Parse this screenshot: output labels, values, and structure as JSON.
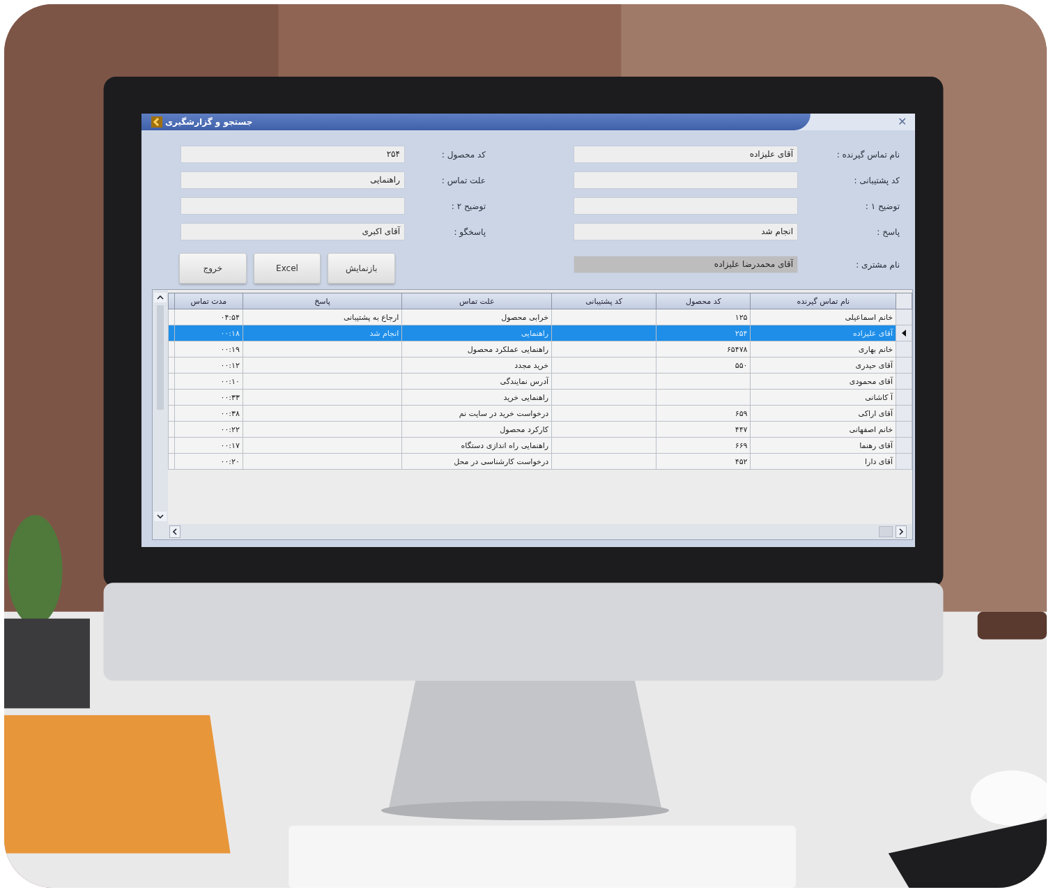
{
  "window": {
    "title": "جستجو و گزارشگیری",
    "close": "✕"
  },
  "form": {
    "right": [
      {
        "label": "نام تماس گیرنده :",
        "value": "آقای علیزاده",
        "disabled": false
      },
      {
        "label": "کد پشتیبانی :",
        "disabled": false
      },
      {
        "label": "توضیح ۱ :",
        "disabled": false
      },
      {
        "label": "پاسخ :",
        "value": "انجام شد",
        "disabled": false
      },
      {
        "label": "نام مشتری :",
        "value": "آقای محمدرضا علیزاده",
        "disabled": true
      }
    ],
    "left": [
      {
        "label": "کد محصول :",
        "value": "۲۵۴",
        "disabled": false
      },
      {
        "label": "علت تماس :",
        "value": "راهنمایی",
        "disabled": false
      },
      {
        "label": "توضیح ۲ :",
        "disabled": false
      },
      {
        "label": "پاسخگو :",
        "value": "آقای اکبری",
        "disabled": false
      }
    ]
  },
  "buttons": [
    "بازنمایش",
    "Excel",
    "خروج"
  ],
  "table": {
    "columns": [
      "نام تماس گیرنده",
      "کد محصول",
      "کد پشتیبانی",
      "علت تماس",
      "پاسخ",
      "مدت تماس"
    ],
    "rows": [
      {
        "cells": [
          "خانم اسماعیلی",
          "۱۲۵",
          "",
          "خرابی محصول",
          "ارجاع به پشتیبانی",
          "۰۴:۵۴"
        ],
        "selected": false
      },
      {
        "cells": [
          "آقای علیزاده",
          "۲۵۴",
          "",
          "راهنمایی",
          "انجام شد",
          "۰۰:۱۸"
        ],
        "selected": true
      },
      {
        "cells": [
          "خانم بهاری",
          "۶۵۴۷۸",
          "",
          "راهنمایی عملکرد محصول",
          "",
          "۰۰:۱۹"
        ],
        "selected": false
      },
      {
        "cells": [
          "آقای حیدری",
          "۵۵۰",
          "",
          "خرید مجدد",
          "",
          "۰۰:۱۲"
        ],
        "selected": false
      },
      {
        "cells": [
          "آقای محمودی",
          "",
          "",
          "آدرس نمایندگی",
          "",
          "۰۰:۱۰"
        ],
        "selected": false
      },
      {
        "cells": [
          "آ کاشانی",
          "",
          "",
          "راهنمایی خرید",
          "",
          "۰۰:۳۳"
        ],
        "selected": false
      },
      {
        "cells": [
          "آقای اراکی",
          "۶۵۹",
          "",
          "درخواست خرید در سایت نم",
          "",
          "۰۰:۳۸"
        ],
        "selected": false
      },
      {
        "cells": [
          "خانم اصفهانی",
          "۴۴۷",
          "",
          "کارکرد محصول",
          "",
          "۰۰:۲۲"
        ],
        "selected": false
      },
      {
        "cells": [
          "آقای رهنما",
          "۶۶۹",
          "",
          "راهنمایی راه اندازی دستگاه",
          "",
          "۰۰:۱۷"
        ],
        "selected": false
      },
      {
        "cells": [
          "آقای دارا",
          "۴۵۲",
          "",
          "درخواست کارشناسی در محل",
          "",
          "۰۰:۲۰"
        ],
        "selected": false
      }
    ]
  }
}
